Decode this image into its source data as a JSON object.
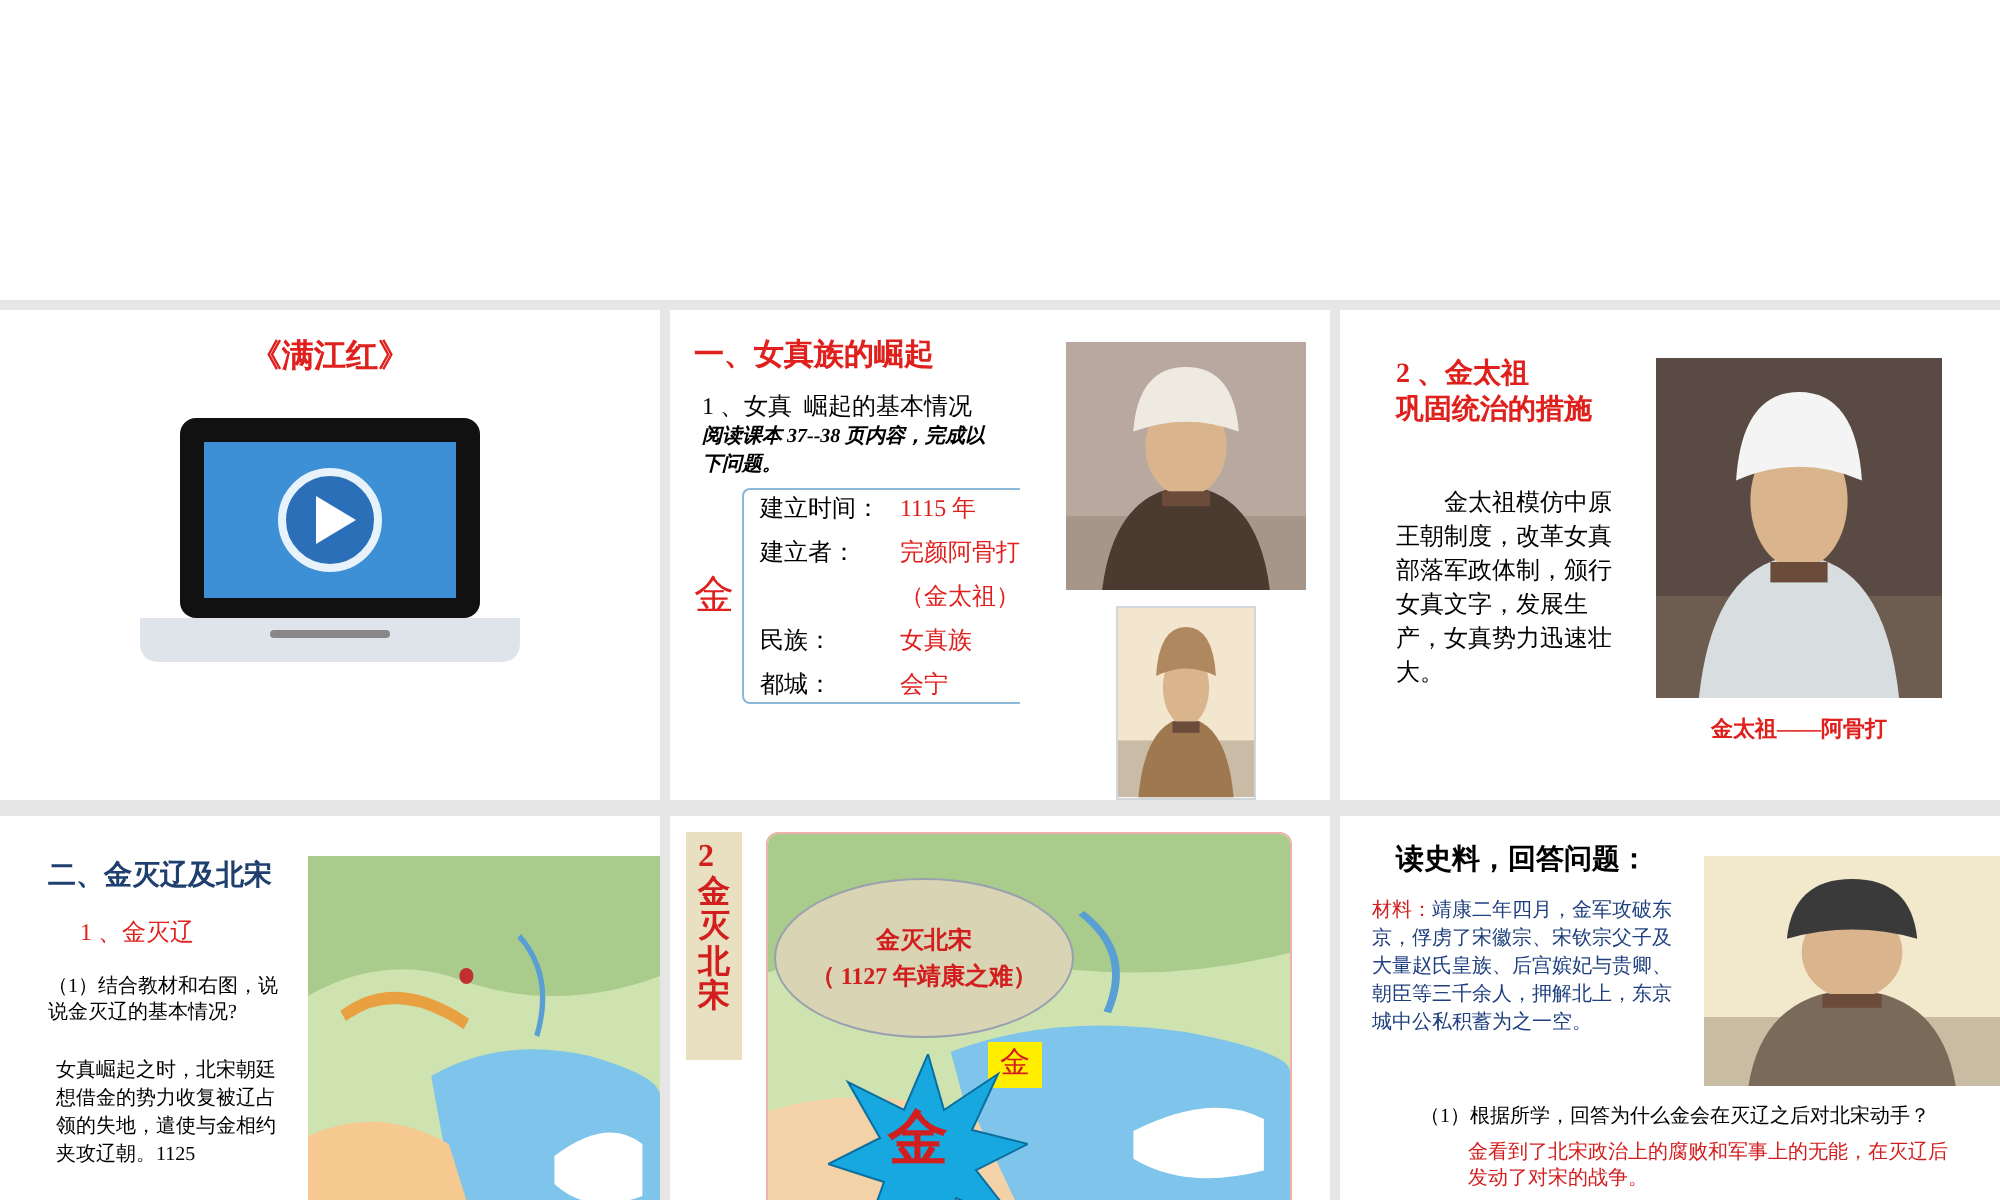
{
  "slides": [
    {
      "kind": "video",
      "title": "《满江红》"
    },
    {
      "kind": "rise",
      "heading": "一、女真族的崛起",
      "subheading": "1 、女真  崛起的基本情况",
      "instruction": "阅读课本 37--38 页内容，完成以下问题。",
      "bracket_label": "金",
      "facts": [
        {
          "label": "建立时间：",
          "value": "1115 年"
        },
        {
          "label": "建立者：",
          "value": "完颜阿骨打"
        },
        {
          "value": "（金太祖）"
        },
        {
          "label": "民族：",
          "value": "女真族"
        },
        {
          "label": "都城：",
          "value": "会宁"
        }
      ]
    },
    {
      "kind": "portrait",
      "heading": [
        "2 、金太祖",
        "巩固统治的措施"
      ],
      "body": "金太祖模仿中原王朝制度，改革女真部落军政体制，颁行女真文字，发展生产，女真势力迅速壮大。",
      "caption": "金太祖——阿骨打"
    },
    {
      "kind": "map_text",
      "heading": "二、金灭辽及北宋",
      "subheading": "1 、金灭辽",
      "question": "（1）结合教材和右图，说说金灭辽的基本情况?",
      "body": "女真崛起之时，北宋朝廷想借金的势力收复被辽占领的失地，遣使与金相约夹攻辽朝。1125"
    },
    {
      "kind": "map_overlay",
      "side_label": "2金灭北宋",
      "bubble": [
        "金灭北宋",
        "（ 1127 年靖康之难）"
      ],
      "tag": "金",
      "burst": "金"
    },
    {
      "kind": "source",
      "heading": "读史料，回答问题：",
      "source_label": "材料：",
      "source_text": "靖康二年四月，金军攻破东京，俘虏了宋徽宗、宋钦宗父子及大量赵氏皇族、后宫嫔妃与贵卿、朝臣等三千余人，押解北上，东京城中公私积蓄为之一空。",
      "question": "（1）根据所学，回答为什么金会在灭辽之后对北宋动手？",
      "answer": "金看到了北宋政治上的腐败和军事上的无能，在灭辽后发动了对宋的战争。"
    }
  ]
}
